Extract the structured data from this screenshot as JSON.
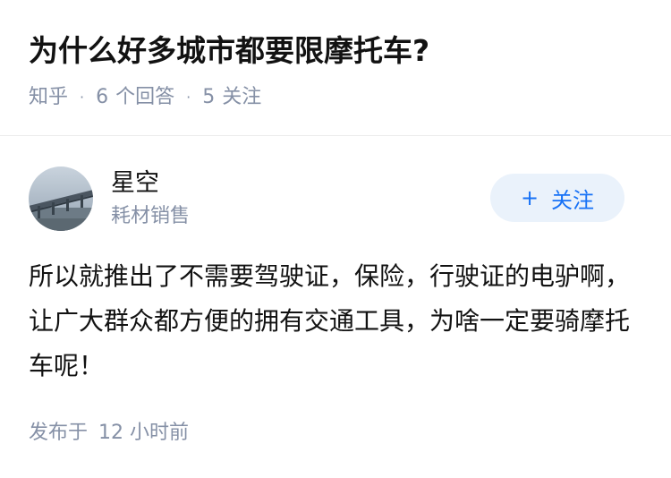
{
  "question": {
    "title": "为什么好多城市都要限摩托车?",
    "source": "知乎",
    "answer_count": "6",
    "answer_label": "个回答",
    "follower_count": "5",
    "follower_label": "关注"
  },
  "author": {
    "name": "星空",
    "bio": "耗材销售",
    "avatar_icon": "bridge-photo-avatar"
  },
  "follow_button": {
    "icon": "plus-icon",
    "plus": "+",
    "label": "关注"
  },
  "answer": {
    "text": "所以就推出了不需要驾驶证，保险，行驶证的电驴啊，让广大群众都方便的拥有交通工具，为啥一定要骑摩托车呢！"
  },
  "publish": {
    "prefix": "发布于",
    "time": "12 小时前"
  },
  "colors": {
    "accent": "#1772f6",
    "follow_bg": "#eaf2fb",
    "meta_gray": "#8590a6",
    "text": "#121212"
  }
}
